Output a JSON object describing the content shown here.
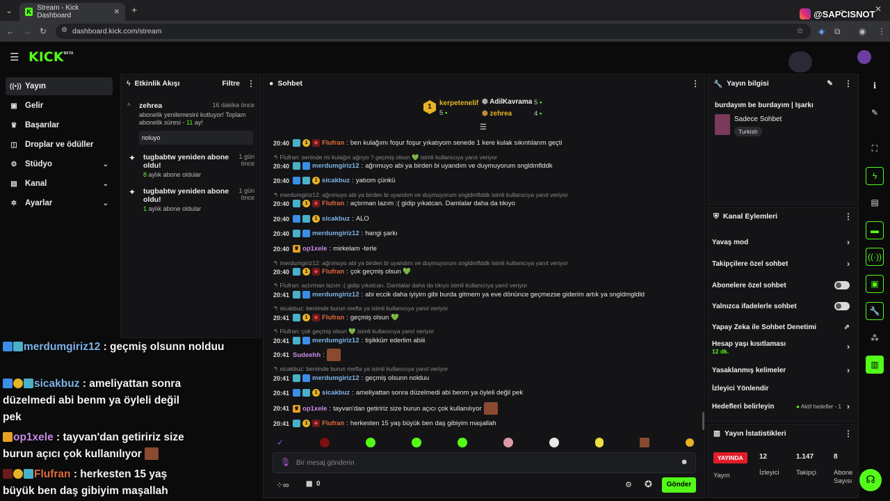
{
  "browser": {
    "tab_title": "Stream - Kick Dashboard",
    "url": "dashboard.kick.com/stream"
  },
  "watermark": "@SAPCISNOT",
  "brand": {
    "logo": "KICK",
    "beta": "BETA",
    "accent": "#53fc18"
  },
  "sidebar": {
    "items": [
      {
        "label": "Yayın",
        "icon": "video-icon",
        "active": true
      },
      {
        "label": "Gelir",
        "icon": "money-icon"
      },
      {
        "label": "Başarılar",
        "icon": "trophy-icon"
      },
      {
        "label": "Droplar ve ödüller",
        "icon": "gift-icon"
      },
      {
        "label": "Stüdyo",
        "icon": "studio-icon",
        "expand": true
      },
      {
        "label": "Kanal",
        "icon": "channel-icon",
        "expand": true
      },
      {
        "label": "Ayarlar",
        "icon": "gear-icon",
        "expand": true
      }
    ]
  },
  "activity": {
    "title": "Etkinlik Akışı",
    "filter": "Filtre",
    "items": [
      {
        "name": "zehrea",
        "time": "16 dakika önce",
        "text": "abonelik yenilemesini kutluyor! Toplam abonelik süresi -",
        "count": "11",
        "count_suffix": "ay!",
        "note": "noluyo"
      },
      {
        "name": "tugbabtw yeniden abone oldu!",
        "time": "1 gün önce",
        "count": "8",
        "count_suffix": "aylık abone oldular"
      },
      {
        "name": "tugbabtw yeniden abone oldu!",
        "time": "1 gün önce",
        "count": "1",
        "count_suffix": "aylık abone oldular"
      }
    ]
  },
  "chat": {
    "title": "Sohbet",
    "leaders": [
      {
        "name": "kerpetenelif",
        "count": "5"
      },
      {
        "name": "AdilKavrama",
        "count": "5"
      },
      {
        "name": "zehrea",
        "count": "4"
      }
    ],
    "messages": [
      {
        "time": "20:40",
        "user": "Flufran",
        "color": "#e36b3a",
        "text": "ben kulağımı foşur foşur yıkatıyom senede 1 kere kulak sıkıntılarım geçti"
      },
      {
        "reply": "Flufran: seninde mi kulağın ağrıyo ? geçmiş olsun 💚 isimli kullanıcıya yanıt veriyor"
      },
      {
        "time": "20:40",
        "user": "merdumgiriz12",
        "color": "#7fb3e8",
        "text": "ağrımuyo abi ya birden bi uyandım ve duymuyorum sngldmflddk"
      },
      {
        "time": "20:40",
        "user": "sicakbuz",
        "color": "#7fb3e8",
        "text": "yatıom çünkü"
      },
      {
        "reply": "merdumgiriz12: ağrımuyo abi ya birden bi uyandım ve duymuyorum sngldmflddk isimli kullanıcıya yanıt veriyor"
      },
      {
        "time": "20:40",
        "user": "Flufran",
        "color": "#e36b3a",
        "text": "açtırman lazım :( gidip yıkatcan. Damlalar daha da tıkıyo"
      },
      {
        "time": "20:40",
        "user": "sicakbuz",
        "color": "#7fb3e8",
        "text": "ALO"
      },
      {
        "time": "20:40",
        "user": "merdumgiriz12",
        "color": "#7fb3e8",
        "text": "hangi şarkı"
      },
      {
        "time": "20:40",
        "user": "op1xele",
        "color": "#c98be8",
        "text": "mirkelam -terle"
      },
      {
        "reply": "merdumgiriz12: ağrımuyo abi ya birden bi uyandım ve duymuyorum sngldmflddk isimli kullanıcıya yanıt veriyor"
      },
      {
        "time": "20:40",
        "user": "Flufran",
        "color": "#e36b3a",
        "text": "çok geçmiş olsun 💚"
      },
      {
        "reply": "Flufran: açtırman lazım :( gidip yıkatcan. Damlalar daha da tıkıyo isimli kullanıcıya yanıt veriyor"
      },
      {
        "time": "20:41",
        "user": "merdumgiriz12",
        "color": "#7fb3e8",
        "text": "abi eccik daha iyiyim gibi burda gitmem ya eve dönünce geçmezse giderim artık ya sngldmgldld"
      },
      {
        "reply": "sicakbuz: benimde burun mefta ya isimli kullanıcıya yanıt veriyor"
      },
      {
        "time": "20:41",
        "user": "Flufran",
        "color": "#e36b3a",
        "text": "geçmiş olsun 💚"
      },
      {
        "reply": "Flufran: çok geçmiş olsun 💚 isimli kullanıcıya yanıt veriyor"
      },
      {
        "time": "20:41",
        "user": "merdumgiriz12",
        "color": "#7fb3e8",
        "text": "tişikkürr ederlim abiii"
      },
      {
        "time": "20:41",
        "user": "Sudeehh",
        "color": "#c98be8",
        "text": ""
      },
      {
        "reply": "sicakbuz: benimde burun mefta ya isimli kullanıcıya yanıt veriyor"
      },
      {
        "time": "20:41",
        "user": "merdumgiriz12",
        "color": "#7fb3e8",
        "text": "geçmiş olsunn nolduu"
      },
      {
        "time": "20:41",
        "user": "sicakbuz",
        "color": "#7fb3e8",
        "text": "ameliyattan sonra düzelmedi abi benm ya öyleli değil pek"
      },
      {
        "time": "20:41",
        "user": "op1xele",
        "color": "#c98be8",
        "text": "tayvan'dan getiririz size burun açıcı çok kullanılıyor"
      },
      {
        "time": "20:41",
        "user": "Flufran",
        "color": "#e36b3a",
        "text": "herkesten 15 yaş büyük ben daş gibiyim maşallah"
      }
    ],
    "input_placeholder": "Bir mesaj gönderin",
    "viewer_count": "0",
    "send": "Gönder"
  },
  "overlay": [
    {
      "user": "merdumgiriz12",
      "color": "#7fb3e8",
      "text": " : geçmiş olsunn nolduu"
    },
    {
      "user": "sicakbuz",
      "color": "#7fb3e8",
      "text": " : ameliyattan sonra düzelmedi abi benm ya öyleli değil pek"
    },
    {
      "user": "op1xele",
      "color": "#c98be8",
      "text": " : tayvan'dan getiririz size burun açıcı çok kullanılıyor"
    },
    {
      "user": "Flufran",
      "color": "#e36b3a",
      "text": " : herkesten 15 yaş büyük ben daş gibiyim maşallah"
    }
  ],
  "stream_info": {
    "title": "Yayın bilgisi",
    "stream_title": "burdayım be burdayım | Işarkı",
    "category": "Sadece Sohbet",
    "tag": "Turkish"
  },
  "channel_actions": {
    "title": "Kanal Eylemleri",
    "items": [
      {
        "label": "Yavaş mod",
        "type": "chevron"
      },
      {
        "label": "Takipçilere özel sohbet",
        "type": "chevron"
      },
      {
        "label": "Abonelere özel sohbet",
        "type": "toggle"
      },
      {
        "label": "Yalnızca ifadelerle sohbet",
        "type": "toggle"
      },
      {
        "label": "Yapay Zeka ile Sohbet Denetimi",
        "type": "external"
      },
      {
        "label": "Hesap yaşı kısıtlaması",
        "sub": "12 dk.",
        "type": "chevron"
      },
      {
        "label": "Yasaklanmış kelimeler",
        "type": "chevron"
      },
      {
        "label": "İzleyici Yönlendir",
        "type": "none"
      },
      {
        "label": "Hedefleri belirleyin",
        "extra": "Aktif hedefler - 1",
        "type": "chevron"
      }
    ]
  },
  "stream_stats": {
    "title": "Yayın İstatistikleri",
    "live": "YAYINDA",
    "live_label": "Yayın",
    "stats": [
      {
        "value": "12",
        "label": "İzleyici"
      },
      {
        "value": "1.147",
        "label": "Takipçi"
      },
      {
        "value": "8",
        "label": "Abone Sayısı"
      }
    ]
  }
}
